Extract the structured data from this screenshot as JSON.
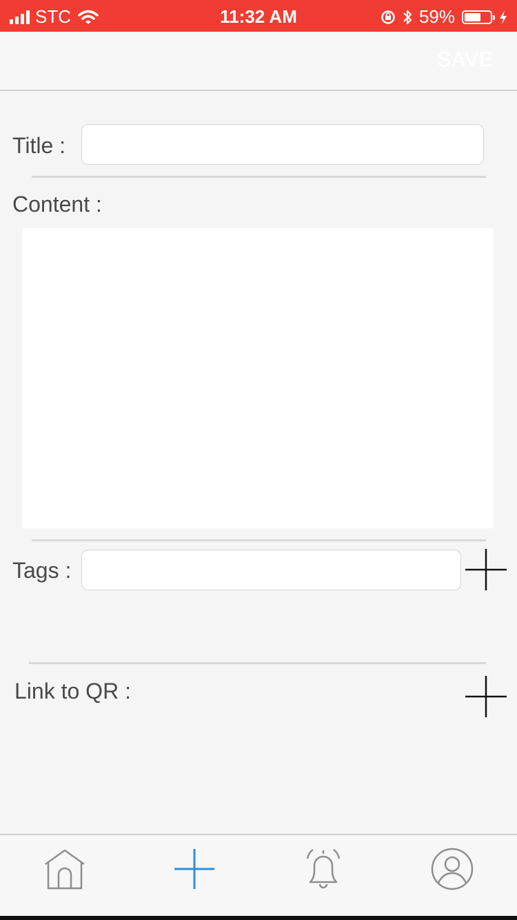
{
  "status_bar": {
    "carrier": "STC",
    "time": "11:32 AM",
    "battery_text": "59%",
    "battery_level": 0.59,
    "background": "#f03c32"
  },
  "nav": {
    "save_label": "SAVE"
  },
  "form": {
    "title_label": "Title :",
    "title_value": "",
    "content_label": "Content :",
    "content_value": "",
    "tags_label": "Tags :",
    "tags_value": "",
    "qr_label": "Link to QR :"
  },
  "tabs": [
    {
      "icon": "home-icon",
      "active": false
    },
    {
      "icon": "plus-icon",
      "active": true
    },
    {
      "icon": "bell-icon",
      "active": false
    },
    {
      "icon": "profile-icon",
      "active": false
    }
  ],
  "colors": {
    "accent": "#2a8fe0",
    "icon_inactive": "#8e8e8e"
  }
}
